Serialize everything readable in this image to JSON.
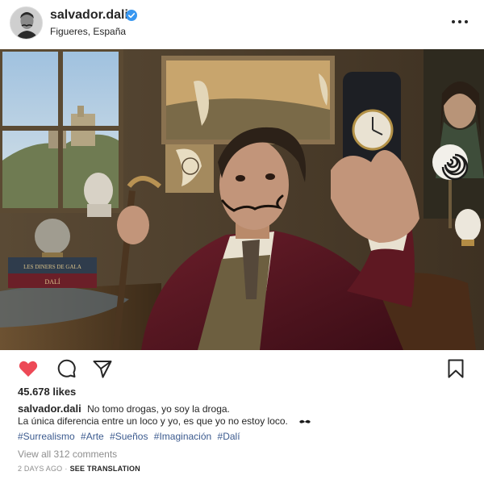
{
  "post": {
    "username": "salvador.dali",
    "location": "Figueres, España",
    "likes": "45.678 likes",
    "caption_user": "salvador.dali",
    "caption_line1": "No tomo drogas, yo soy la droga.",
    "caption_line2": "La única diferencia entre un loco y yo, es que yo no estoy loco.",
    "caption_emoji": "mustache",
    "hashtags": [
      "#Surrealismo",
      "#Arte",
      "#Sueños",
      "#Imaginación",
      "#Dalí"
    ],
    "view_comments": "View all 312 comments",
    "time_ago": "2 DAYS AGO",
    "separator": "·",
    "see_translation": "SEE TRANSLATION"
  },
  "photo": {
    "book_title": "LES DINERS DE GALA",
    "book_author": "DALÍ"
  },
  "icons": {
    "verified": "verified-badge-icon",
    "more": "more-options-icon",
    "like": "heart-icon",
    "comment": "comment-icon",
    "share": "paper-plane-icon",
    "save": "bookmark-icon"
  },
  "colors": {
    "like_red": "#ed4956",
    "verified_blue": "#3897f0",
    "hashtag": "#3b5a8e",
    "muted": "#8e8e8e"
  }
}
